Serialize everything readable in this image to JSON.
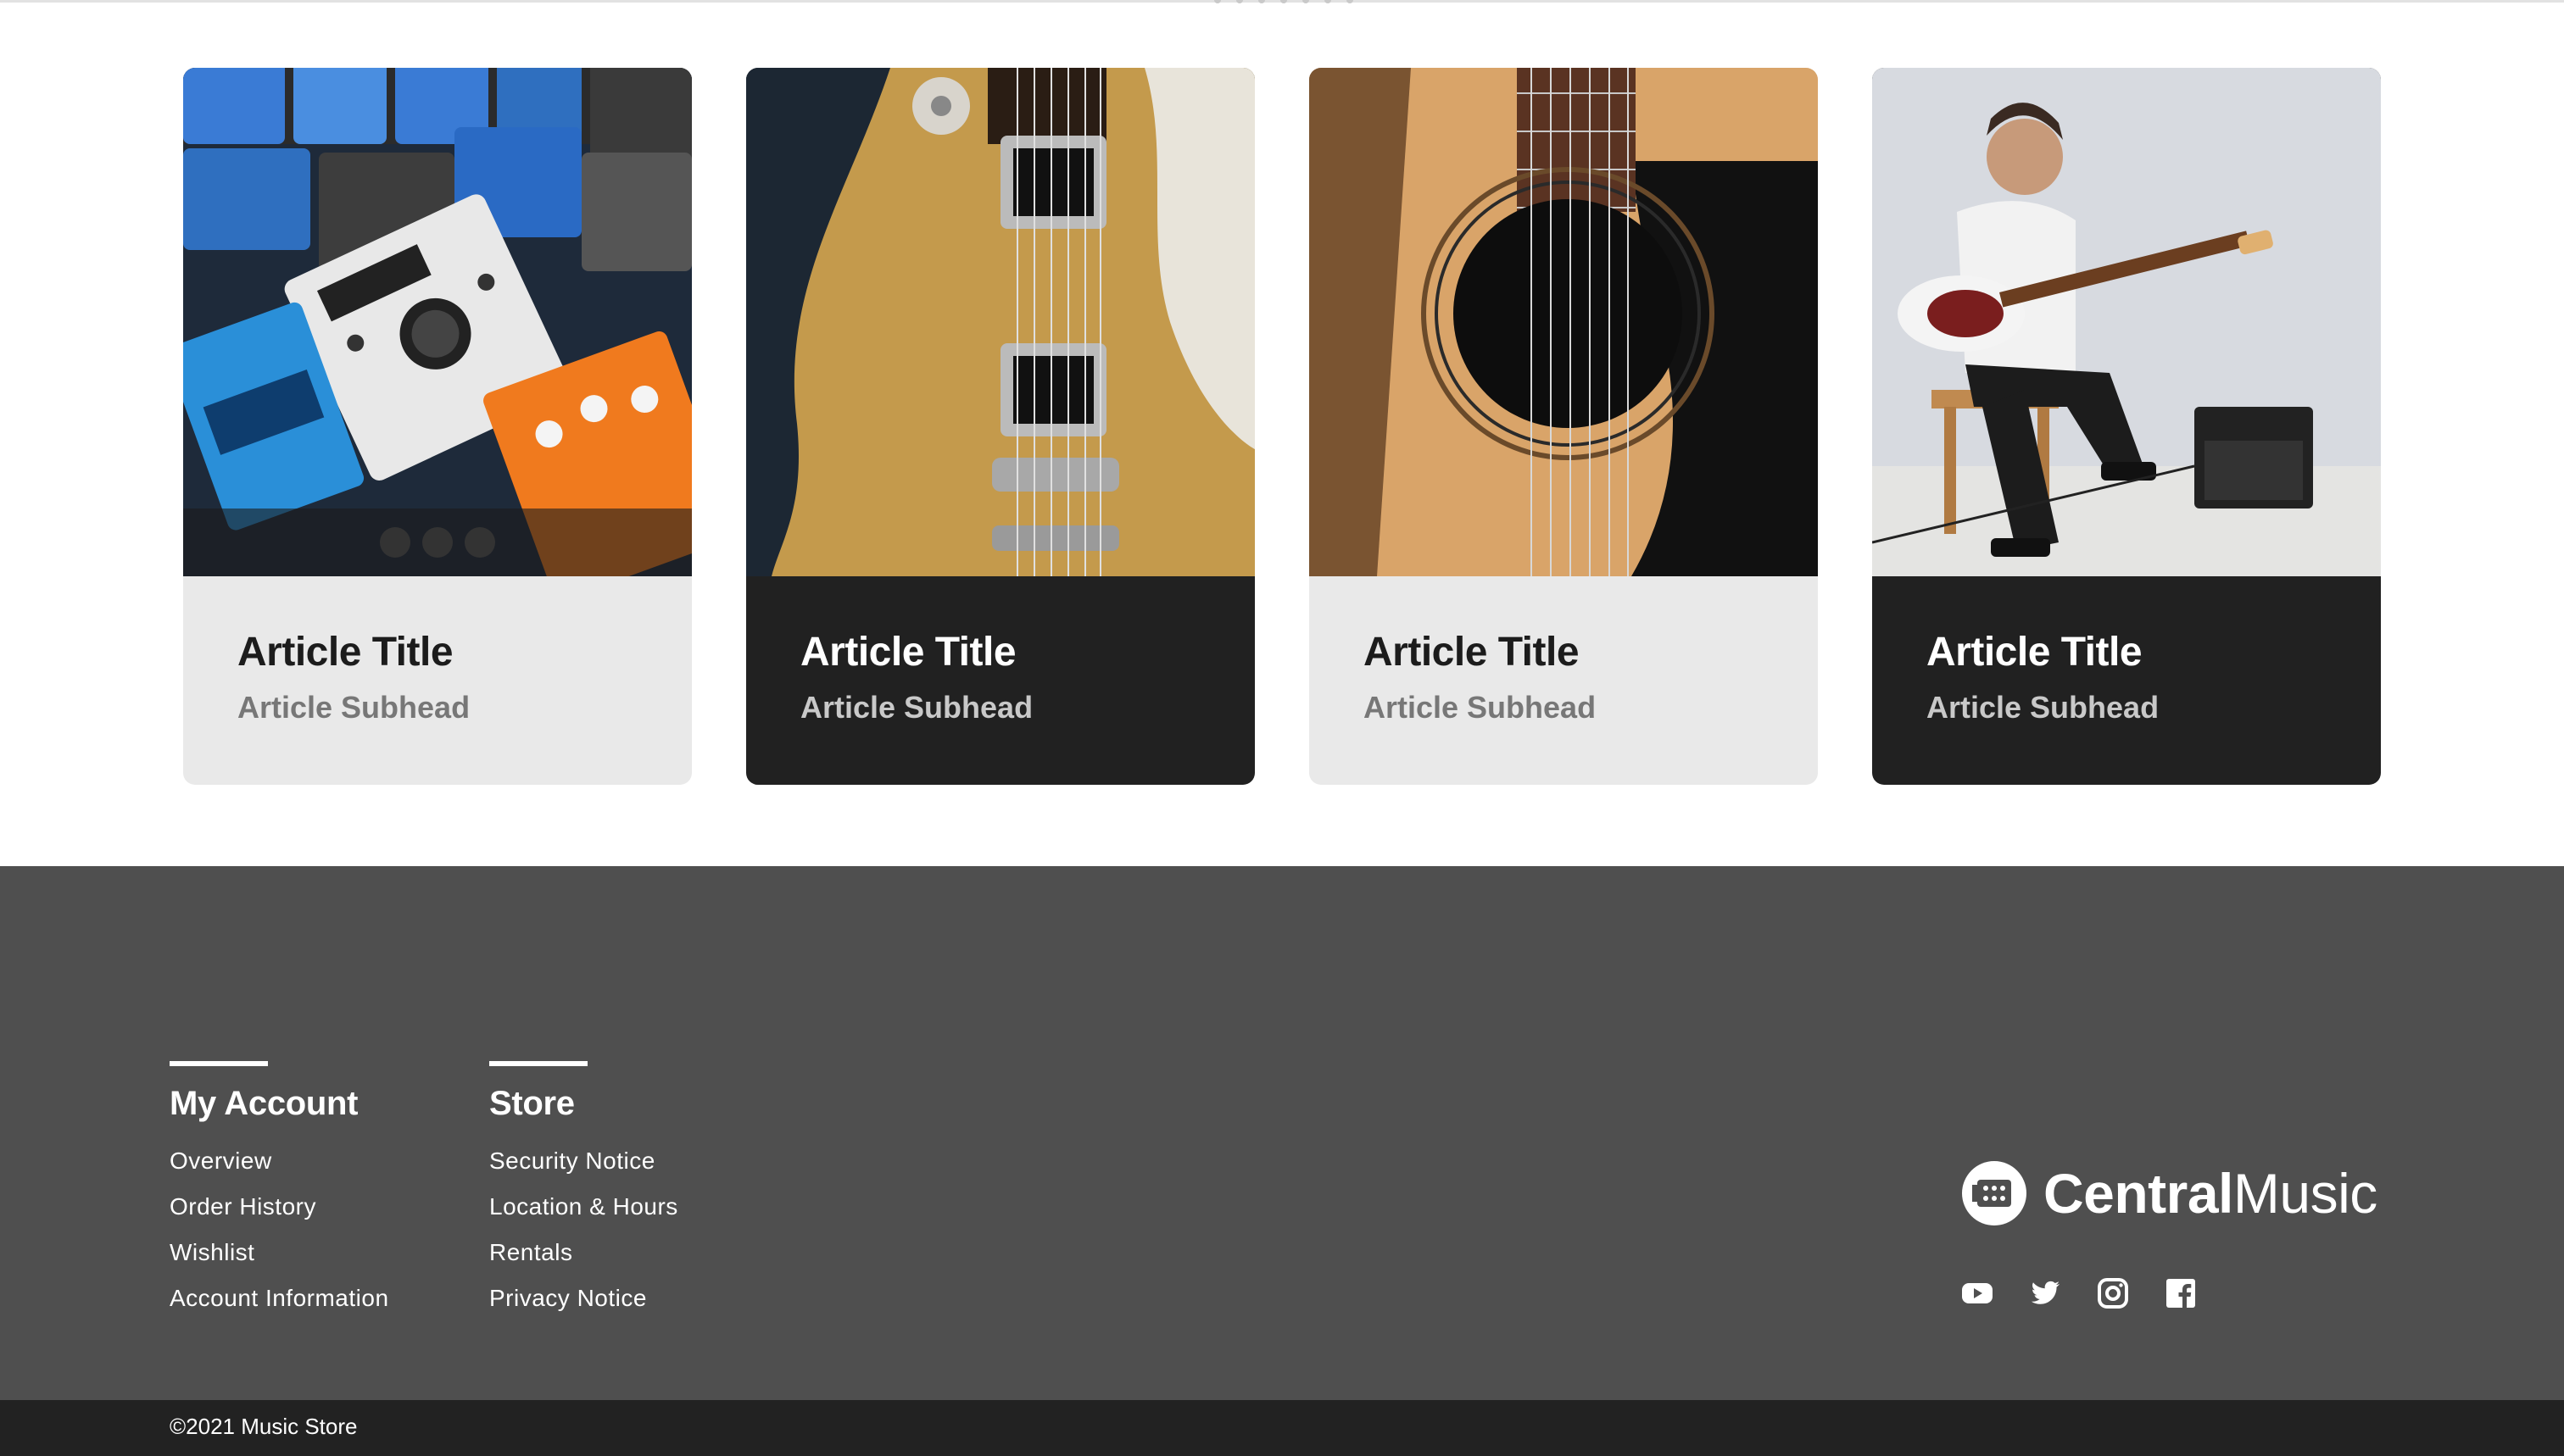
{
  "articles": [
    {
      "title": "Article Title",
      "subhead": "Article Subhead",
      "theme": "light",
      "image": "effects-pedals-photo"
    },
    {
      "title": "Article Title",
      "subhead": "Article Subhead",
      "theme": "dark",
      "image": "electric-guitar-photo"
    },
    {
      "title": "Article Title",
      "subhead": "Article Subhead",
      "theme": "light",
      "image": "acoustic-guitar-photo"
    },
    {
      "title": "Article Title",
      "subhead": "Article Subhead",
      "theme": "dark",
      "image": "guitarist-photo"
    }
  ],
  "footer": {
    "account": {
      "heading": "My Account",
      "links": [
        "Overview",
        "Order History",
        "Wishlist",
        "Account Information"
      ]
    },
    "store": {
      "heading": "Store",
      "links": [
        "Security Notice",
        "Location & Hours",
        "Rentals",
        "Privacy Notice"
      ]
    },
    "brand": {
      "name_strong": "Central",
      "name_light": "Music",
      "logo_icon": "guitar-headstock-icon"
    },
    "socials": [
      "youtube-icon",
      "twitter-icon",
      "instagram-icon",
      "facebook-icon"
    ],
    "copyright": "©2021 Music Store"
  },
  "colors": {
    "card_light": "#e9e9e9",
    "card_dark": "#212121",
    "footer_bg": "#4f4f4f",
    "bottom_bar": "#222222"
  }
}
